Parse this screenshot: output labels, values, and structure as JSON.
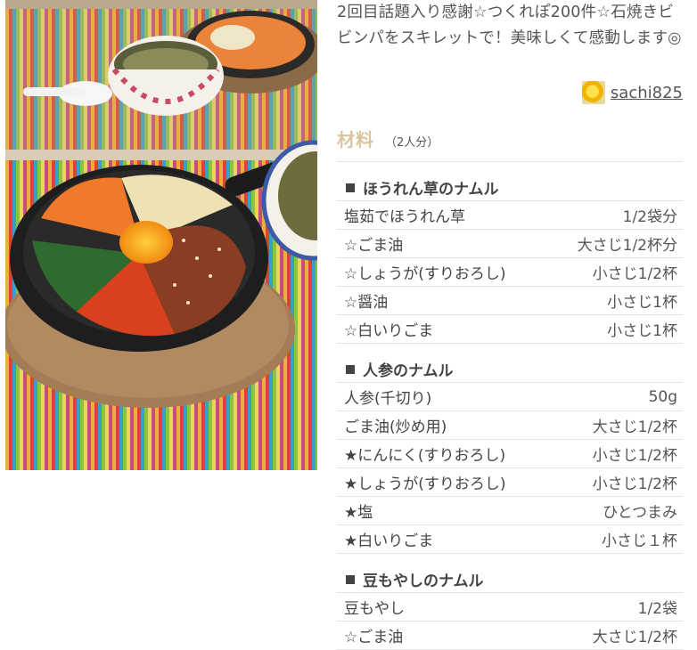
{
  "recipe": {
    "description": "2回目話題入り感謝☆つくれぽ200件☆石焼きビビンパをスキレットで！美味しくて感動します◎",
    "author": "sachi825",
    "photo_alt": "石焼きビビンパ"
  },
  "ingredients": {
    "title": "材料",
    "serving": "（2人分）",
    "sections": [
      {
        "name": "ほうれん草のナムル",
        "items": [
          {
            "name": "塩茹でほうれん草",
            "amount": "1/2袋分"
          },
          {
            "name": "☆ごま油",
            "amount": "大さじ1/2杯分"
          },
          {
            "name": "☆しょうが(すりおろし)",
            "amount": "小さじ1/2杯"
          },
          {
            "name": "☆醤油",
            "amount": "小さじ1杯"
          },
          {
            "name": "☆白いりごま",
            "amount": "小さじ1杯"
          }
        ]
      },
      {
        "name": "人参のナムル",
        "items": [
          {
            "name": "人参(千切り)",
            "amount": "50g"
          },
          {
            "name": "ごま油(炒め用)",
            "amount": "大さじ1/2杯"
          },
          {
            "name": "★にんにく(すりおろし)",
            "amount": "小さじ1/2杯"
          },
          {
            "name": "★しょうが(すりおろし)",
            "amount": "小さじ1/2杯"
          },
          {
            "name": "★塩",
            "amount": "ひとつまみ"
          },
          {
            "name": "★白いりごま",
            "amount": "小さじ１杯"
          }
        ]
      },
      {
        "name": "豆もやしのナムル",
        "items": [
          {
            "name": "豆もやし",
            "amount": "1/2袋"
          },
          {
            "name": "☆ごま油",
            "amount": "大さじ1/2杯"
          }
        ]
      }
    ]
  }
}
